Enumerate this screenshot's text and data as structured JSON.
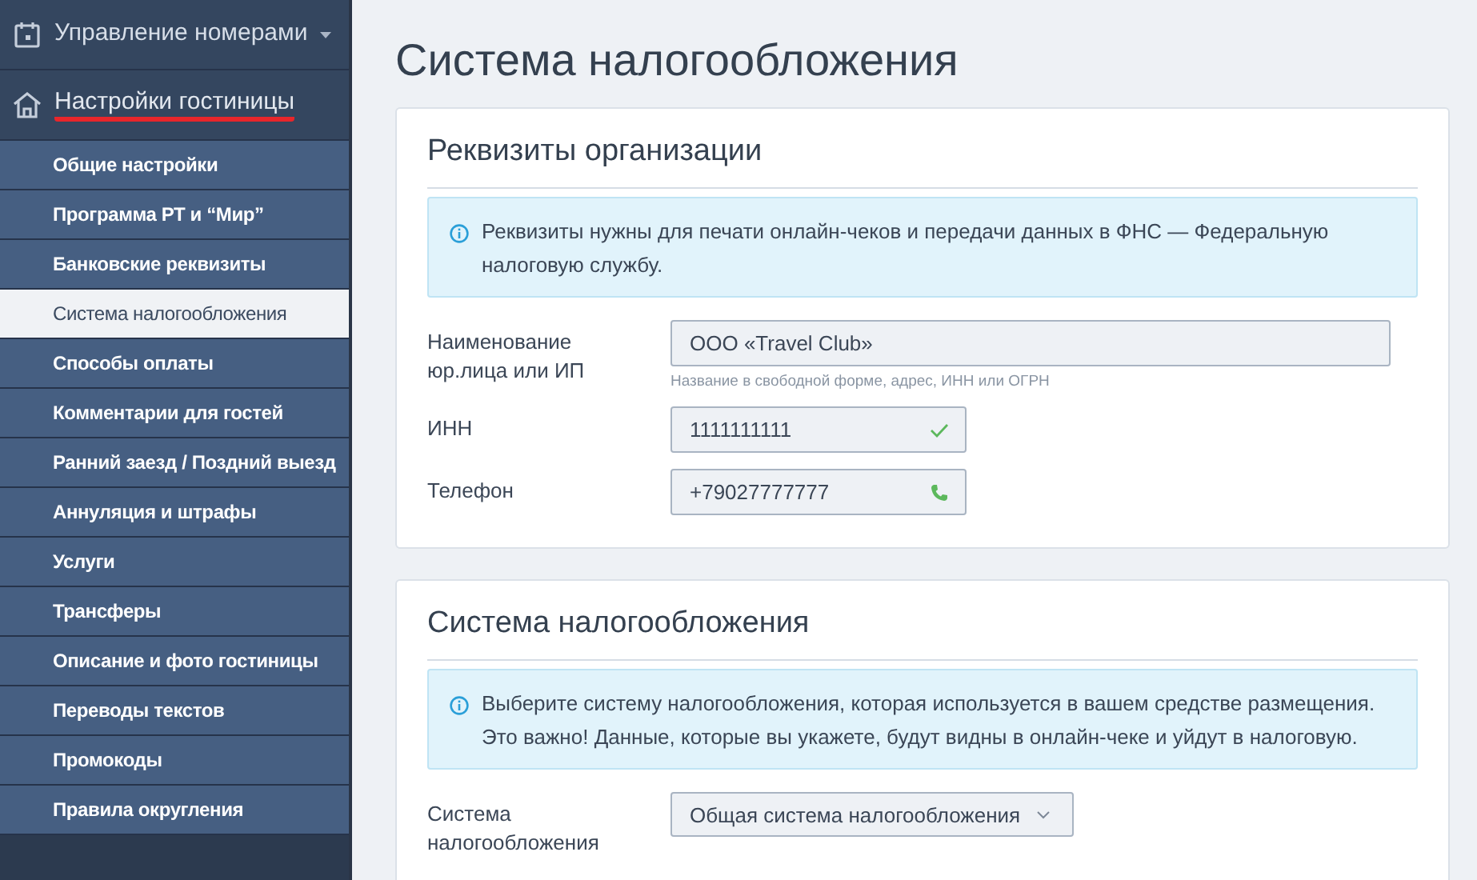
{
  "sidebar": {
    "sections": [
      {
        "label": "Управление номерами",
        "kind": "calendar",
        "expanded": false,
        "selected": false
      },
      {
        "label": "Настройки гостиницы",
        "kind": "home",
        "expanded": true,
        "selected": true
      }
    ],
    "items": [
      {
        "label": "Общие настройки",
        "selected": false
      },
      {
        "label": "Программа РТ и “Мир”",
        "selected": false
      },
      {
        "label": "Банковские реквизиты",
        "selected": false
      },
      {
        "label": "Система налогообложения",
        "selected": true
      },
      {
        "label": "Способы оплаты",
        "selected": false
      },
      {
        "label": "Комментарии для гостей",
        "selected": false
      },
      {
        "label": "Ранний заезд / Поздний выезд",
        "selected": false
      },
      {
        "label": "Аннуляция и штрафы",
        "selected": false
      },
      {
        "label": "Услуги",
        "selected": false
      },
      {
        "label": "Трансферы",
        "selected": false
      },
      {
        "label": "Описание и фото гостиницы",
        "selected": false
      },
      {
        "label": "Переводы текстов",
        "selected": false
      },
      {
        "label": "Промокоды",
        "selected": false
      },
      {
        "label": "Правила округления",
        "selected": false
      }
    ]
  },
  "page": {
    "title": "Система налогообложения"
  },
  "cards": [
    {
      "title": "Реквизиты организации",
      "notice": "Реквизиты нужны для печати онлайн-чеков и передачи данных в ФНС — Федеральную налоговую службу.",
      "fields": [
        {
          "label": "Наименование юр.лица или ИП",
          "kind": "text",
          "value": "ООО «Travel Club»",
          "hint": "Название в свободной форме, адрес, ИНН или ОГРН"
        },
        {
          "label": "ИНН",
          "kind": "checked-text",
          "value": "1111111111"
        },
        {
          "label": "Телефон",
          "kind": "phone-text",
          "value": "+79027777777"
        }
      ]
    },
    {
      "title": "Система налогообложения",
      "notice": "Выберите систему налогообложения, которая используется в вашем средстве размещения. Это важно! Данные, которые вы укажете, будут видны в онлайн-чеке и уйдут в налоговую.",
      "fields": [
        {
          "label": "Система налогообложения",
          "kind": "select",
          "value": "Общая система налогообложения"
        }
      ]
    }
  ]
}
